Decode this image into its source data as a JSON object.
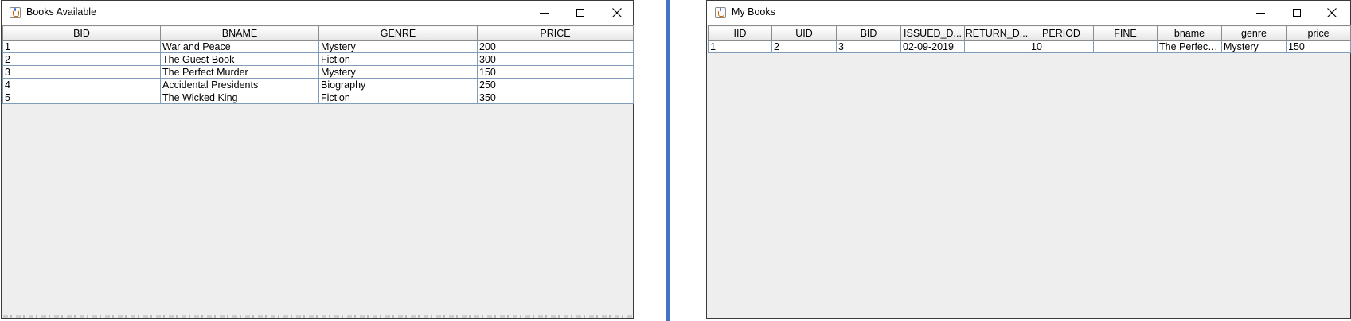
{
  "left_window": {
    "title": "Books Available",
    "controls": {
      "minimize": "minimize",
      "maximize": "maximize",
      "close": "close"
    },
    "columns": [
      "BID",
      "BNAME",
      "GENRE",
      "PRICE"
    ],
    "rows": [
      [
        "1",
        "War and Peace",
        "Mystery",
        "200"
      ],
      [
        "2",
        "The Guest Book",
        "Fiction",
        "300"
      ],
      [
        "3",
        "The Perfect Murder",
        "Mystery",
        "150"
      ],
      [
        "4",
        "Accidental Presidents",
        "Biography",
        "250"
      ],
      [
        "5",
        "The Wicked King",
        "Fiction",
        "350"
      ]
    ]
  },
  "right_window": {
    "title": "My Books",
    "controls": {
      "minimize": "minimize",
      "maximize": "maximize",
      "close": "close"
    },
    "columns": [
      "IID",
      "UID",
      "BID",
      "ISSUED_D...",
      "RETURN_D...",
      "PERIOD",
      "FINE",
      "bname",
      "genre",
      "price"
    ],
    "rows": [
      [
        "1",
        "2",
        "3",
        "02-09-2019",
        "",
        "10",
        "",
        "The Perfect ...",
        "Mystery",
        "150"
      ]
    ]
  },
  "icons": {
    "app_icon": "java-coffee-cup-icon",
    "minimize": "minimize-icon",
    "maximize": "maximize-icon",
    "close": "close-icon"
  },
  "colors": {
    "divider": "#4472c4",
    "window_bg": "#eeeeee",
    "grid_line": "#7f9db9"
  }
}
